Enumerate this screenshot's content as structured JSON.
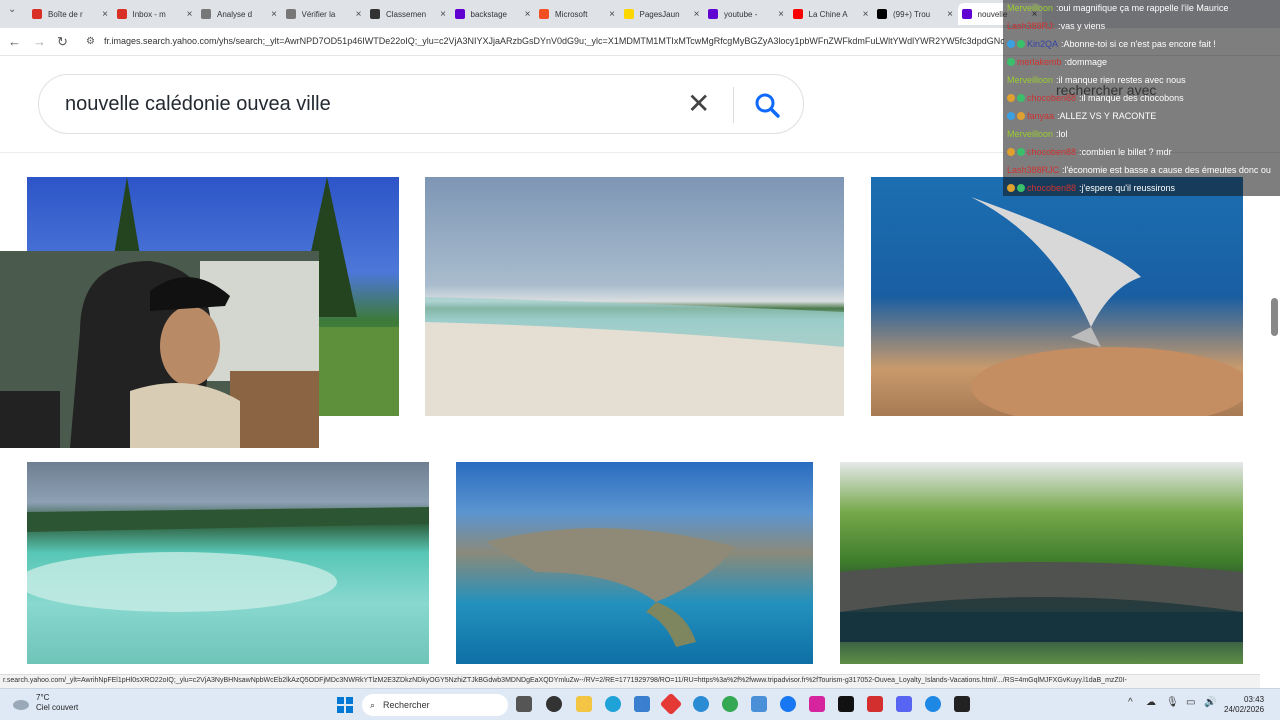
{
  "tabs": [
    {
      "label": "Boîte de r",
      "color": "#d93025"
    },
    {
      "label": "Inbox - m",
      "color": "#d93025"
    },
    {
      "label": "Analyse d",
      "color": "#777777"
    },
    {
      "label": "Vérifier la",
      "color": "#777777"
    },
    {
      "label": "Classemen",
      "color": "#333333"
    },
    {
      "label": "backstage",
      "color": "#6001d2"
    },
    {
      "label": "Microsoft",
      "color": "#f25022"
    },
    {
      "label": "PagesJaun",
      "color": "#ffd700"
    },
    {
      "label": "youtube -",
      "color": "#6001d2"
    },
    {
      "label": "La Chine A",
      "color": "#ff0000"
    },
    {
      "label": "(99+) Trou",
      "color": "#000000"
    },
    {
      "label": "nouvelle",
      "color": "#6001d2"
    }
  ],
  "url": "fr.images.search.yahoo.com/yhs/search;_ylt=AwrNPD7OD51p46IWTDe22oIQ;_ylu=c2VjA3NIYXJjaARzbGsDYnV0dG9u;_ylc=X1MDMTM1MTIxMTcwMgRfcgMyBGZyA3locy1pbWFnZWFkdmFuLWltYWdlYWR2YW5fc3dpdGNoBGdwcmlkAw--",
  "search": {
    "query": "nouvelle calédonie ouvea ville",
    "clear": "✕"
  },
  "chat": [
    {
      "user": "Merveilloon",
      "user_color": "#9acd32",
      "msg": "oui magnifique ça me rappelle l'ile Maurice",
      "badges": []
    },
    {
      "user": "Lash388RJ:",
      "user_color": "#cc3333",
      "msg": "vas y viens",
      "badges": []
    },
    {
      "user": "Kin2QA",
      "user_color": "#3344aa",
      "msg": "Abonne-toi si ce n'est pas encore fait !",
      "badges": [
        "#3aa0e0",
        "#3ac06a"
      ]
    },
    {
      "user": "merlakemb",
      "user_color": "#cc3333",
      "msg": "dommage",
      "badges": [
        "#3ac06a"
      ]
    },
    {
      "user": "Merveilloon",
      "user_color": "#9acd32",
      "msg": "il manque rien restes avec nous",
      "badges": []
    },
    {
      "user": "chocoben88",
      "user_color": "#cc3333",
      "msg": "il manque des chocobons",
      "badges": [
        "#e0a030",
        "#3ac06a"
      ]
    },
    {
      "user": "fanyaa",
      "user_color": "#cc3333",
      "msg": "ALLEZ VS Y RACONTE",
      "badges": [
        "#3aa0e0",
        "#e0a030"
      ]
    },
    {
      "user": "Merveilloon",
      "user_color": "#9acd32",
      "msg": "lol",
      "badges": []
    },
    {
      "user": "chocoben88",
      "user_color": "#cc3333",
      "msg": "combien le billet ? mdr",
      "badges": [
        "#e0a030",
        "#3ac06a"
      ]
    },
    {
      "user": "Lash388RJC",
      "user_color": "#cc3333",
      "msg": "l'économie est basse a cause des émeutes donc ou",
      "badges": []
    },
    {
      "user": "chocoben88",
      "user_color": "#cc3333",
      "msg": "j'espere qu'il reussirons",
      "badges": [
        "#e0a030",
        "#3ac06a"
      ]
    }
  ],
  "overlay_text": "rechercher avec",
  "status_url": "r.search.yahoo.com/_ylt=AwrihNpFEl1pHl0sXRO22oIQ;_ylu=c2VjA3NyBHNsawNpbWcEb2lkAzQ5ODFjMDc3NWRkYTlzM2E3ZDkzNDkyOGY5NzhiZTJkBGdwb3MDNDgEaXQDYmluZw--/RV=2/RE=1771929798/RO=11/RU=https%3a%2f%2fwww.tripadvisor.fr%2fTourism-g317052-Ouvea_Loyalty_Islands-Vacations.html/.../RS=4mGqlMJFXGvKuyy.l1daB_mzZ0I-",
  "taskbar": {
    "temp": "7°C",
    "weather": "Ciel couvert",
    "search_label": "Rechercher",
    "time": "03:43",
    "date": "24/02/2026"
  }
}
